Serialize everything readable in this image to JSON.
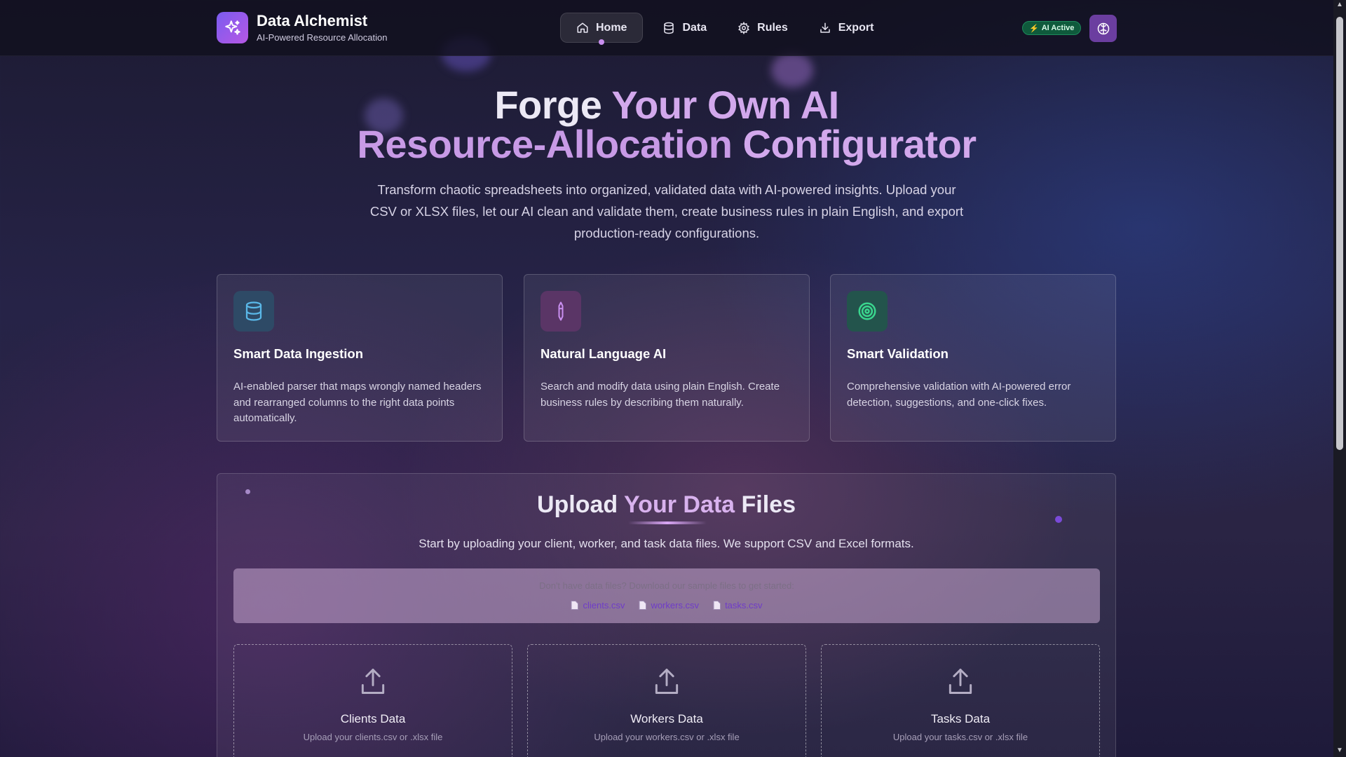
{
  "brand": {
    "title": "Data Alchemist",
    "subtitle": "AI-Powered Resource Allocation",
    "logo_icon": "sparkles-icon"
  },
  "nav": {
    "items": [
      {
        "label": "Home",
        "icon": "home-icon",
        "active": true
      },
      {
        "label": "Data",
        "icon": "database-icon",
        "active": false
      },
      {
        "label": "Rules",
        "icon": "gear-icon",
        "active": false
      },
      {
        "label": "Export",
        "icon": "download-icon",
        "active": false
      }
    ]
  },
  "status": {
    "ai_badge": "AI Active",
    "brain_button_icon": "brain-icon"
  },
  "hero": {
    "title_line1_a": "Forge ",
    "title_line1_b": "Your Own AI",
    "title_line2_a": "Resource-Allocation ",
    "title_line2_b": "Configurator",
    "description": "Transform chaotic spreadsheets into organized, validated data with AI-powered insights. Upload your CSV or XLSX files, let our AI clean and validate them, create business rules in plain English, and export production-ready configurations."
  },
  "features": [
    {
      "title": "Smart Data Ingestion",
      "description": "AI-enabled parser that maps wrongly named headers and rearranged columns to the right data points automatically.",
      "icon": "database-icon",
      "color": "#5ab8e8"
    },
    {
      "title": "Natural Language AI",
      "description": "Search and modify data using plain English. Create business rules by describing them naturally.",
      "icon": "pen-icon",
      "color": "#c98ff0"
    },
    {
      "title": "Smart Validation",
      "description": "Comprehensive validation with AI-powered error detection, suggestions, and one-click fixes.",
      "icon": "target-icon",
      "color": "#3ad68e"
    }
  ],
  "upload": {
    "title_a": "Upload ",
    "title_b": "Your Data",
    "title_c": " Files",
    "description": "Start by uploading your client, worker, and task data files. We support CSV and Excel formats.",
    "samples_hint": "Don't have data files? Download our sample files to get started:",
    "sample_files": [
      "clients.csv",
      "workers.csv",
      "tasks.csv"
    ],
    "dropzones": [
      {
        "title": "Clients Data",
        "hint": "Upload your clients.csv or .xlsx file",
        "icon": "upload-icon"
      },
      {
        "title": "Workers Data",
        "hint": "Upload your workers.csv or .xlsx file",
        "icon": "upload-icon"
      },
      {
        "title": "Tasks Data",
        "hint": "Upload your tasks.csv or .xlsx file",
        "icon": "upload-icon"
      }
    ]
  }
}
